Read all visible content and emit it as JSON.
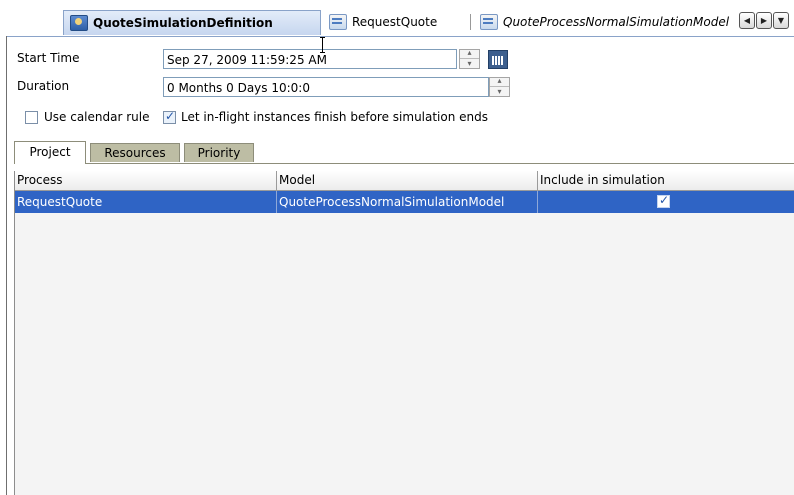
{
  "editor_tabs": [
    {
      "label": "QuoteSimulationDefinition",
      "icon": "simulation-definition-icon",
      "active": true
    },
    {
      "label": "RequestQuote",
      "icon": "process-icon",
      "active": false
    },
    {
      "label": "QuoteProcessNormalSimulationModel",
      "icon": "simulation-model-icon",
      "active": false
    }
  ],
  "nav": {
    "left": "◀",
    "right": "▶",
    "menu": "▼"
  },
  "form": {
    "start_time_label": "Start Time",
    "start_time_value": "Sep 27, 2009 11:59:25 AM",
    "duration_label": "Duration",
    "duration_value": "0 Months 0 Days 10:0:0",
    "use_calendar_rule_label": "Use calendar rule",
    "use_calendar_rule_checked": false,
    "let_inflight_label": "Let in-flight instances finish before simulation ends",
    "let_inflight_checked": true
  },
  "sub_tabs": [
    {
      "label": "Project",
      "active": true
    },
    {
      "label": "Resources",
      "active": false
    },
    {
      "label": "Priority",
      "active": false
    }
  ],
  "table": {
    "columns": [
      "Process",
      "Model",
      "Include in simulation"
    ],
    "rows": [
      {
        "process": "RequestQuote",
        "model": "QuoteProcessNormalSimulationModel",
        "include": true,
        "selected": true
      }
    ]
  },
  "colors": {
    "selection": "#2f64c5",
    "inactive_tab": "#bdbda4",
    "active_editor_tab": "#c6d6ef",
    "table_background": "#f4f4f4"
  }
}
